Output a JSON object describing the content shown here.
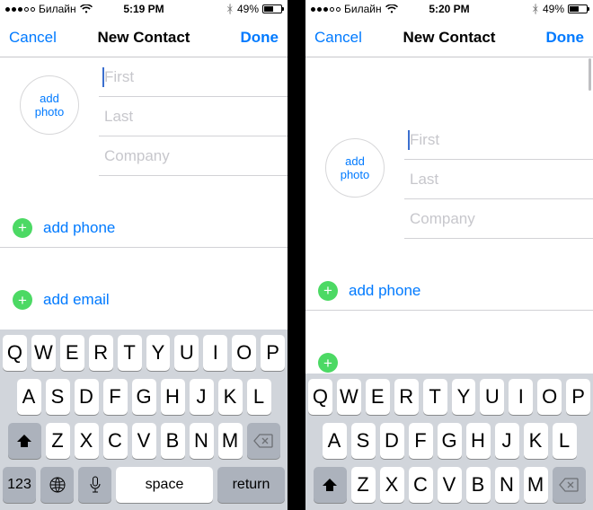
{
  "left": {
    "status": {
      "carrier": "Билайн",
      "time": "5:19 PM",
      "battery_pct": "49%"
    },
    "nav": {
      "cancel": "Cancel",
      "title": "New Contact",
      "done": "Done"
    },
    "photo_label_l1": "add",
    "photo_label_l2": "photo",
    "fields": {
      "first": "First",
      "last": "Last",
      "company": "Company"
    },
    "actions": {
      "phone": "add phone",
      "email": "add email"
    }
  },
  "right": {
    "status": {
      "carrier": "Билайн",
      "time": "5:20 PM",
      "battery_pct": "49%"
    },
    "nav": {
      "cancel": "Cancel",
      "title": "New Contact",
      "done": "Done"
    },
    "photo_label_l1": "add",
    "photo_label_l2": "photo",
    "fields": {
      "first": "First",
      "last": "Last",
      "company": "Company"
    },
    "actions": {
      "phone": "add phone"
    }
  },
  "kbd": {
    "r1": [
      "Q",
      "W",
      "E",
      "R",
      "T",
      "Y",
      "U",
      "I",
      "O",
      "P"
    ],
    "r2": [
      "A",
      "S",
      "D",
      "F",
      "G",
      "H",
      "J",
      "K",
      "L"
    ],
    "r3": [
      "Z",
      "X",
      "C",
      "V",
      "B",
      "N",
      "M"
    ],
    "numkey": "123",
    "space": "space",
    "return": "return"
  }
}
